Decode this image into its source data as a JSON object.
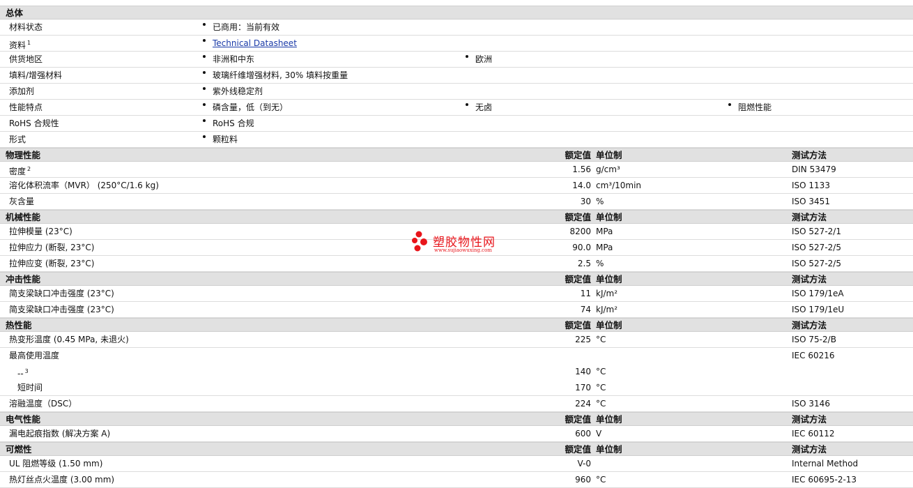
{
  "general": {
    "title": "总体",
    "rows": [
      {
        "label": "材料状态",
        "items": [
          "已商用：当前有效"
        ]
      },
      {
        "label": "资料",
        "sup": "1",
        "items": [
          "Technical Datasheet"
        ]
      },
      {
        "label": "供货地区",
        "items": [
          "非洲和中东",
          "欧洲"
        ]
      },
      {
        "label": "填料/增强材料",
        "items": [
          "玻璃纤维增强材料, 30% 填料按重量"
        ]
      },
      {
        "label": "添加剂",
        "items": [
          "紫外线稳定剂"
        ]
      },
      {
        "label": "性能特点",
        "items": [
          "磷含量，低（到无）",
          "无卤",
          "阻燃性能"
        ]
      },
      {
        "label": "RoHS 合规性",
        "items": [
          "RoHS 合规"
        ]
      },
      {
        "label": "形式",
        "items": [
          "颗粒料"
        ]
      }
    ]
  },
  "columns": {
    "value": "额定值",
    "unit": "单位制",
    "test": "测试方法"
  },
  "sections": [
    {
      "title": "物理性能",
      "rows": [
        {
          "label": "密度",
          "sup": "2",
          "value": "1.56",
          "unit": "g/cm³",
          "test": "DIN 53479"
        },
        {
          "label": "溶化体积流率（MVR） (250°C/1.6 kg)",
          "value": "14.0",
          "unit": "cm³/10min",
          "test": "ISO 1133"
        },
        {
          "label": "灰含量",
          "value": "30",
          "unit": "%",
          "test": "ISO 3451"
        }
      ]
    },
    {
      "title": "机械性能",
      "rows": [
        {
          "label": "拉伸模量 (23°C)",
          "value": "8200",
          "unit": "MPa",
          "test": "ISO 527-2/1"
        },
        {
          "label": "拉伸应力 (断裂, 23°C)",
          "value": "90.0",
          "unit": "MPa",
          "test": "ISO 527-2/5"
        },
        {
          "label": "拉伸应变 (断裂, 23°C)",
          "value": "2.5",
          "unit": "%",
          "test": "ISO 527-2/5"
        }
      ]
    },
    {
      "title": "冲击性能",
      "rows": [
        {
          "label": "简支梁缺口冲击强度 (23°C)",
          "value": "11",
          "unit": "kJ/m²",
          "test": "ISO 179/1eA"
        },
        {
          "label": "简支梁缺口冲击强度 (23°C)",
          "value": "74",
          "unit": "kJ/m²",
          "test": "ISO 179/1eU"
        }
      ]
    },
    {
      "title": "热性能",
      "rows": [
        {
          "label": "热变形温度 (0.45 MPa, 未退火)",
          "value": "225",
          "unit": "°C",
          "test": "ISO 75-2/B"
        },
        {
          "label": "最高使用温度",
          "value": "",
          "unit": "",
          "test": "IEC 60216",
          "noline": true
        },
        {
          "label": "--",
          "sup": "3",
          "value": "140",
          "unit": "°C",
          "test": "",
          "indent": true,
          "noline": true
        },
        {
          "label": "短时间",
          "value": "170",
          "unit": "°C",
          "test": "",
          "indent": true
        },
        {
          "label": "溶融温度（DSC）",
          "value": "224",
          "unit": "°C",
          "test": "ISO 3146"
        }
      ]
    },
    {
      "title": "电气性能",
      "rows": [
        {
          "label": "漏电起痕指数 (解决方案 A)",
          "value": "600",
          "unit": "V",
          "test": "IEC 60112"
        }
      ]
    },
    {
      "title": "可燃性",
      "rows": [
        {
          "label": "UL 阻燃等级 (1.50 mm)",
          "value": "V-0",
          "unit": "",
          "test": "Internal Method"
        },
        {
          "label": "热灯丝点火温度 (3.00 mm)",
          "value": "960",
          "unit": "°C",
          "test": "IEC 60695-2-13"
        }
      ]
    }
  ],
  "watermark": {
    "title": "塑胶物性网",
    "url": "www.sujiaowuxing.com"
  },
  "colors": {
    "header_bg": "#e1e1e1",
    "link": "#1a3aa8",
    "watermark": "#e8151b"
  }
}
